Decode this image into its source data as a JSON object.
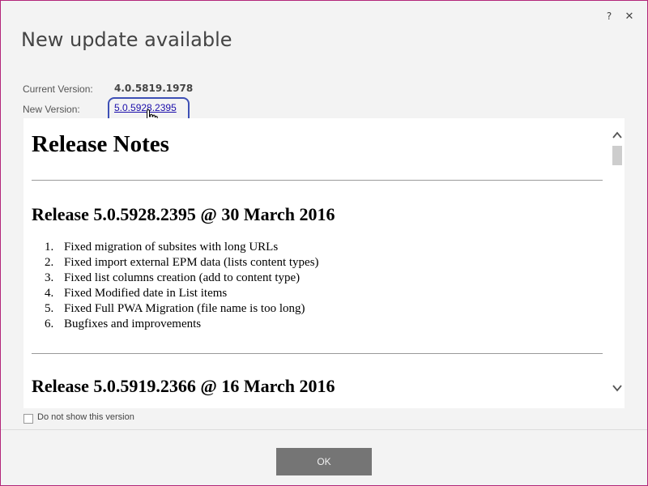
{
  "dialog": {
    "title": "New update available",
    "help_label": "?",
    "close_label": "✕"
  },
  "versions": {
    "current_label": "Current Version:",
    "current_value": "4.0.5819.1978",
    "new_label": "New Version:",
    "new_value": "5.0.5928.2395"
  },
  "release_notes": {
    "heading": "Release Notes",
    "releases": [
      {
        "title": "Release 5.0.5928.2395 @ 30 March 2016",
        "items": [
          {
            "num": "1.",
            "text": "Fixed migration of subsites with long URLs"
          },
          {
            "num": "2.",
            "text": "Fixed import external EPM data (lists content types)"
          },
          {
            "num": "3.",
            "text": "Fixed list columns creation (add to content type)"
          },
          {
            "num": "4.",
            "text": "Fixed Modified date in List items"
          },
          {
            "num": "5.",
            "text": "Fixed Full PWA Migration (file name is too long)"
          },
          {
            "num": "6.",
            "text": "Bugfixes and improvements"
          }
        ]
      },
      {
        "title": "Release 5.0.5919.2366 @ 16 March 2016"
      }
    ]
  },
  "footer": {
    "dont_show_label": "Do not show this version",
    "ok_label": "OK"
  },
  "colors": {
    "window_border": "#b2267a",
    "link": "#1a0dab",
    "highlight_ring": "#3d4fb5",
    "ok_button": "#757575"
  },
  "icons": {
    "help": "question-mark",
    "close": "x-mark",
    "cursor": "hand-pointer",
    "scroll_up": "chevron-up",
    "scroll_down": "chevron-down"
  }
}
